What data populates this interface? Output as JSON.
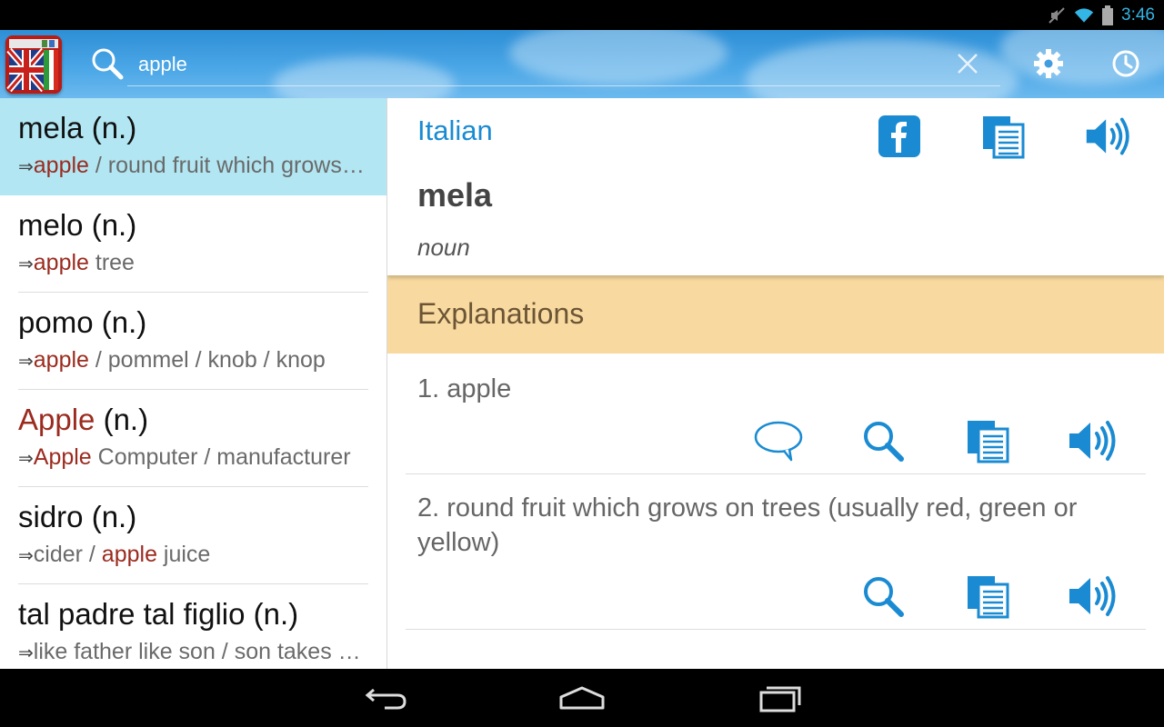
{
  "status_bar": {
    "time": "3:46",
    "icons": [
      "mute-icon",
      "wifi-icon",
      "battery-icon"
    ],
    "time_color": "#33b5e5"
  },
  "toolbar": {
    "search": {
      "value": "apple"
    },
    "icons": [
      "app-logo-flags-icon",
      "search-icon",
      "clear-icon",
      "gear-icon",
      "history-clock-icon"
    ]
  },
  "results": [
    {
      "word": "mela",
      "pos": " (n.)",
      "word_highlight": false,
      "translation_parts": [
        {
          "text": "apple",
          "hl": true
        },
        {
          "text": " / round fruit which grows on trees",
          "hl": false
        }
      ]
    },
    {
      "word": "melo",
      "pos": " (n.)",
      "word_highlight": false,
      "translation_parts": [
        {
          "text": "apple",
          "hl": true
        },
        {
          "text": " tree",
          "hl": false
        }
      ]
    },
    {
      "word": "pomo",
      "pos": " (n.)",
      "word_highlight": false,
      "translation_parts": [
        {
          "text": "apple",
          "hl": true
        },
        {
          "text": " / pommel / knob / knop",
          "hl": false
        }
      ]
    },
    {
      "word": "Apple",
      "pos": " (n.)",
      "word_highlight": true,
      "translation_parts": [
        {
          "text": "Apple",
          "hl": true
        },
        {
          "text": " Computer / manufacturer",
          "hl": false
        }
      ]
    },
    {
      "word": "sidro",
      "pos": " (n.)",
      "word_highlight": false,
      "translation_parts": [
        {
          "text": "cider / ",
          "hl": false
        },
        {
          "text": "apple",
          "hl": true
        },
        {
          "text": " juice",
          "hl": false
        }
      ]
    },
    {
      "word": "tal padre tal figlio",
      "pos": " (n.)",
      "word_highlight": false,
      "translation_parts": [
        {
          "text": "like father like son / son takes after",
          "hl": false
        }
      ]
    }
  ],
  "results_arrow": "⇒",
  "detail": {
    "language": "Italian",
    "headword": "mela",
    "part_of_speech": "noun",
    "header_icons": [
      "facebook-icon",
      "copy-icon",
      "speaker-icon"
    ],
    "section_title": "Explanations",
    "definitions": [
      {
        "text": "1. apple",
        "actions": [
          "comment-icon",
          "search-icon",
          "copy-icon",
          "speaker-icon"
        ]
      },
      {
        "text": "2. round fruit which grows on trees (usually red, green or yellow)",
        "actions": [
          "search-icon",
          "copy-icon",
          "speaker-icon"
        ]
      }
    ]
  },
  "colors": {
    "accent_blue": "#1a8bd2",
    "highlight_red": "#9b2b1f",
    "selected_row": "#b1e6f2",
    "section_bar": "#f8d9a0"
  },
  "nav_bar": {
    "icons": [
      "back-icon",
      "home-icon",
      "recents-icon"
    ]
  }
}
